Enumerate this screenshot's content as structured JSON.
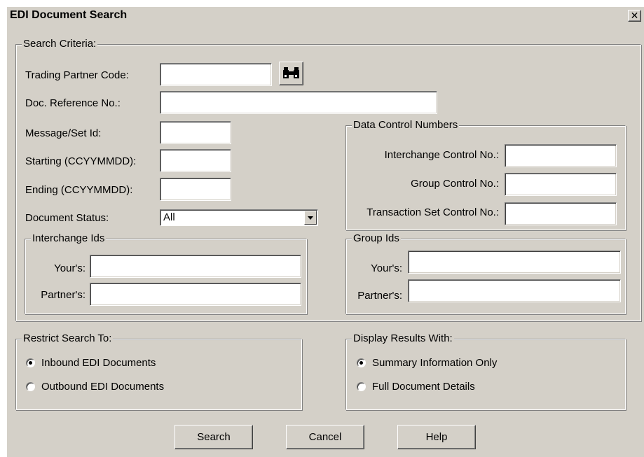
{
  "window": {
    "title": "EDI Document Search",
    "close_glyph": "✕"
  },
  "search_criteria": {
    "legend": "Search Criteria:",
    "trading_partner_code": {
      "label": "Trading Partner Code:",
      "value": ""
    },
    "find_icon": "binoculars-icon",
    "doc_reference_no": {
      "label": "Doc. Reference No.:",
      "value": ""
    },
    "message_set_id": {
      "label": "Message/Set Id:",
      "value": ""
    },
    "starting": {
      "label": "Starting (CCYYMMDD):",
      "value": ""
    },
    "ending": {
      "label": "Ending (CCYYMMDD):",
      "value": ""
    },
    "document_status": {
      "label": "Document Status:",
      "value": "All"
    },
    "data_control_numbers": {
      "legend": "Data Control Numbers",
      "interchange": {
        "label": "Interchange Control No.:",
        "value": ""
      },
      "group": {
        "label": "Group Control No.:",
        "value": ""
      },
      "transaction_set": {
        "label": "Transaction Set Control No.:",
        "value": ""
      }
    },
    "interchange_ids": {
      "legend": "Interchange Ids",
      "yours": {
        "label": "Your's:",
        "value": ""
      },
      "partners": {
        "label": "Partner's:",
        "value": ""
      }
    },
    "group_ids": {
      "legend": "Group Ids",
      "yours": {
        "label": "Your's:",
        "value": ""
      },
      "partners": {
        "label": "Partner's:",
        "value": ""
      }
    }
  },
  "restrict_search": {
    "legend": "Restrict Search To:",
    "options": [
      {
        "label": "Inbound EDI Documents",
        "checked": true
      },
      {
        "label": "Outbound EDI Documents",
        "checked": false
      }
    ]
  },
  "display_results": {
    "legend": "Display Results With:",
    "options": [
      {
        "label": "Summary Information Only",
        "checked": true
      },
      {
        "label": "Full Document Details",
        "checked": false
      }
    ]
  },
  "buttons": {
    "search": "Search",
    "cancel": "Cancel",
    "help": "Help"
  },
  "colors": {
    "face": "#d4d0c8",
    "field": "#ffffff",
    "shadow": "#808080",
    "highlight": "#ffffff"
  }
}
